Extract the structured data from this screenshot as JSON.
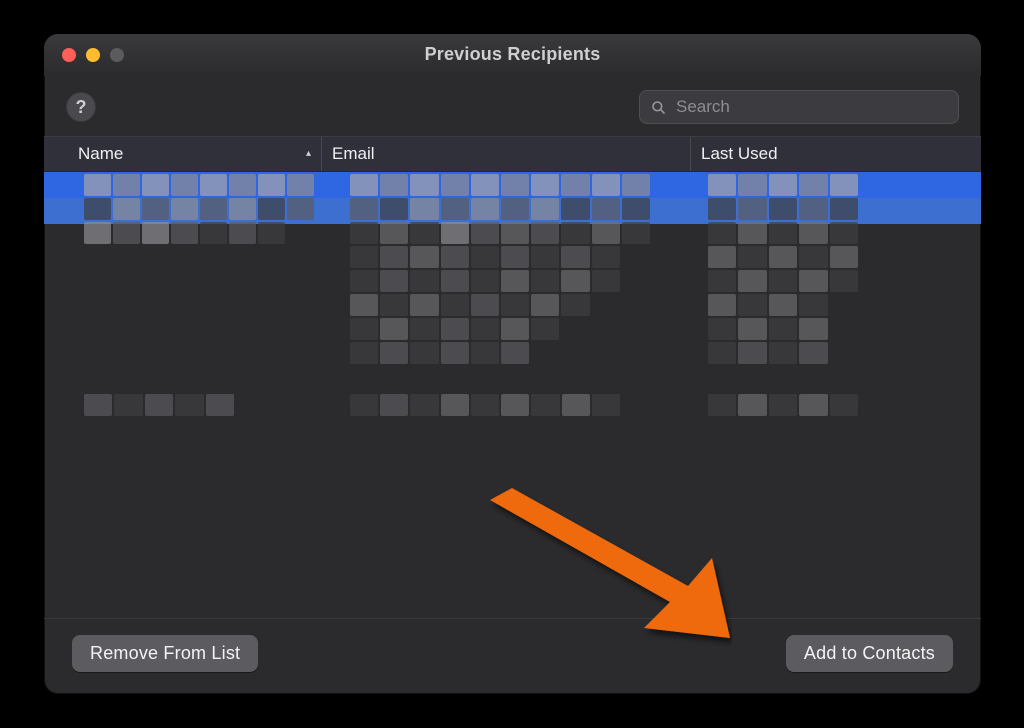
{
  "window": {
    "title": "Previous Recipients"
  },
  "toolbar": {
    "help_label": "?",
    "search_placeholder": "Search",
    "search_value": ""
  },
  "columns": {
    "name": "Name",
    "email": "Email",
    "last_used": "Last Used",
    "sort_indicator": "▴"
  },
  "footer": {
    "remove_label": "Remove From List",
    "add_label": "Add to Contacts"
  },
  "annotation": {
    "target": "add-to-contacts-button"
  }
}
